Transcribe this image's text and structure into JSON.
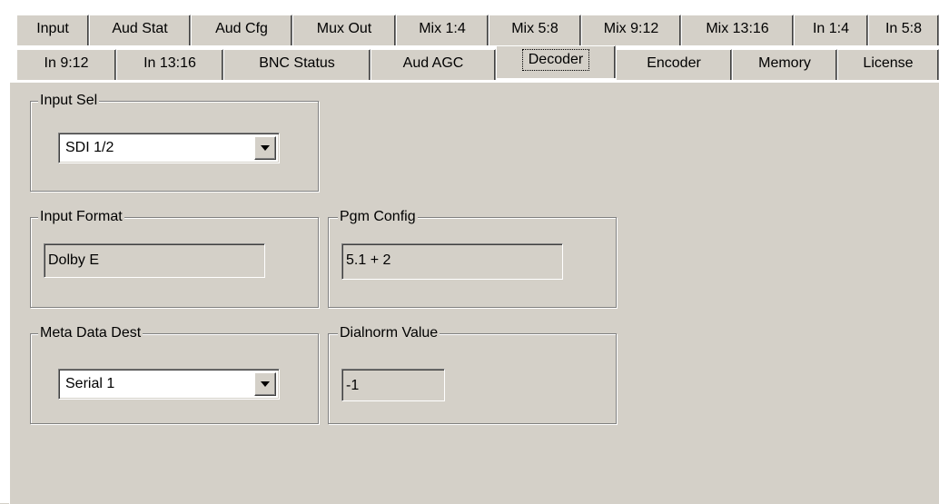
{
  "tabs_row1": [
    "Input",
    "Aud Stat",
    "Aud Cfg",
    "Mux Out",
    "Mix 1:4",
    "Mix 5:8",
    "Mix 9:12",
    "Mix 13:16",
    "In 1:4",
    "In 5:8"
  ],
  "tabs_row2": [
    "In 9:12",
    "In 13:16",
    "BNC Status",
    "Aud AGC",
    "Decoder",
    "Encoder",
    "Memory",
    "License"
  ],
  "active_tab": "Decoder",
  "input_sel": {
    "legend": "Input Sel",
    "value": "SDI 1/2"
  },
  "input_format": {
    "legend": "Input Format",
    "value": "Dolby E"
  },
  "pgm_config": {
    "legend": "Pgm Config",
    "value": "5.1 + 2"
  },
  "meta_data_dest": {
    "legend": "Meta Data Dest",
    "value": "Serial 1"
  },
  "dialnorm": {
    "legend": "Dialnorm Value",
    "value": "-1"
  }
}
